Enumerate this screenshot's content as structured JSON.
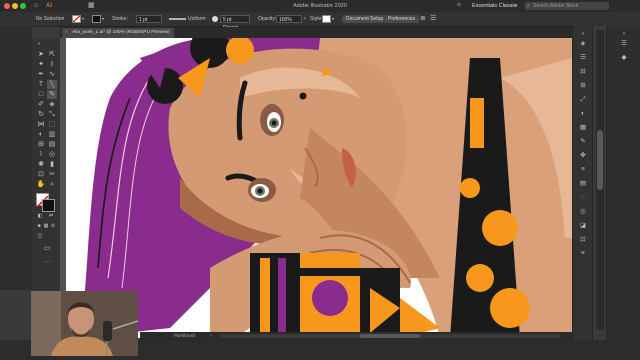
{
  "titlebar": {
    "app_title": "Adobe Illustrator 2020",
    "workspace": "Essentials Classic",
    "search_placeholder": "Search Adobe Stock"
  },
  "controlbar": {
    "selection": "No Selection",
    "stroke_label": "Stroke:",
    "stroke_weight": "1 pt",
    "profile": "Uniform",
    "brush": "5 pt. Round",
    "opacity_label": "Opacity:",
    "opacity_value": "100%",
    "style_label": "Style:",
    "doc_setup": "Document Setup",
    "preferences": "Preferences"
  },
  "tab": {
    "label": "Aila_work_1.ai* @ 100% (RGB/GPU Preview)",
    "close": "×"
  },
  "statusbar": {
    "tool": "Paintbrush"
  },
  "colors": {
    "skin": "#d49a74",
    "skin_light": "#e6b895",
    "skin_dark": "#a86a48",
    "hair": "#8a2b8e",
    "accent_orange": "#f7981d",
    "black": "#1a1a1a",
    "background": "#ffffff"
  }
}
